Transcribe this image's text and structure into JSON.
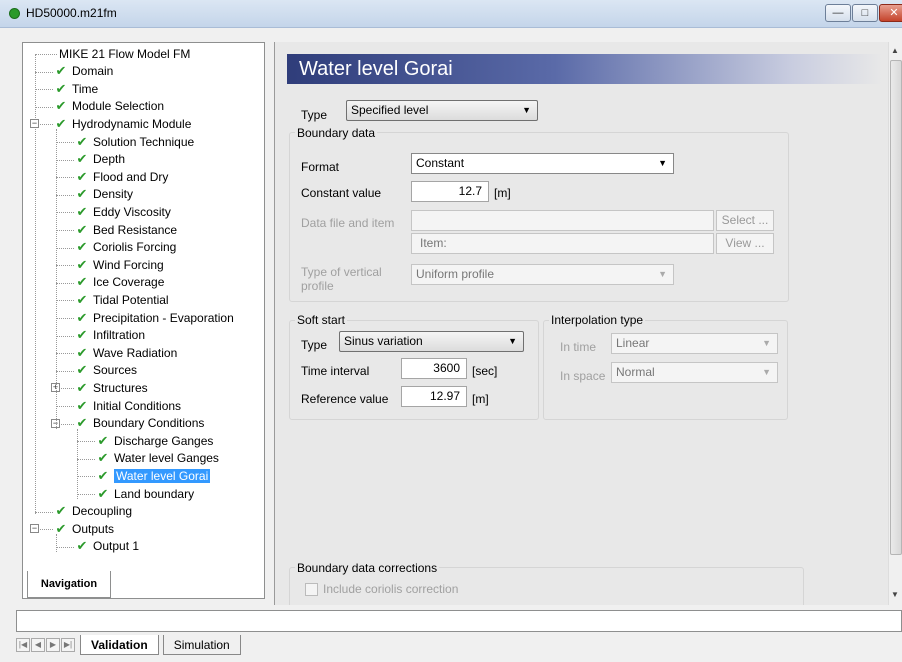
{
  "window": {
    "title": "HD50000.m21fm"
  },
  "tree": {
    "root": "MIKE 21 Flow Model FM",
    "items": [
      "Domain",
      "Time",
      "Module Selection",
      "Hydrodynamic Module",
      "Solution Technique",
      "Depth",
      "Flood and Dry",
      "Density",
      "Eddy Viscosity",
      "Bed Resistance",
      "Coriolis Forcing",
      "Wind Forcing",
      "Ice Coverage",
      "Tidal Potential",
      "Precipitation - Evaporation",
      "Infiltration",
      "Wave Radiation",
      "Sources",
      "Structures",
      "Initial Conditions",
      "Boundary Conditions",
      "Discharge Ganges",
      "Water level Ganges",
      "Water level Gorai",
      "Land boundary",
      "Decoupling",
      "Outputs",
      "Output 1"
    ],
    "selected": "Water level Gorai"
  },
  "nav_tab": "Navigation",
  "content": {
    "title": "Water level Gorai",
    "type_label": "Type",
    "type_value": "Specified level",
    "boundary_data": {
      "title": "Boundary data",
      "format_label": "Format",
      "format_value": "Constant",
      "constant_label": "Constant value",
      "constant_value": "12.7",
      "constant_unit": "[m]",
      "datafile_label": "Data file and item",
      "select_btn": "Select ...",
      "item_placeholder": "Item:",
      "view_btn": "View ...",
      "vertical_label_1": "Type of vertical",
      "vertical_label_2": "profile",
      "vertical_value": "Uniform profile"
    },
    "soft_start": {
      "title": "Soft start",
      "type_label": "Type",
      "type_value": "Sinus variation",
      "interval_label": "Time interval",
      "interval_value": "3600",
      "interval_unit": "[sec]",
      "ref_label": "Reference value",
      "ref_value": "12.97",
      "ref_unit": "[m]"
    },
    "interpolation": {
      "title": "Interpolation type",
      "time_label": "In time",
      "time_value": "Linear",
      "space_label": "In space",
      "space_value": "Normal"
    },
    "corrections": {
      "title": "Boundary data corrections",
      "coriolis_label": "Include coriolis correction"
    }
  },
  "bottom_tabs": [
    "Validation",
    "Simulation"
  ]
}
